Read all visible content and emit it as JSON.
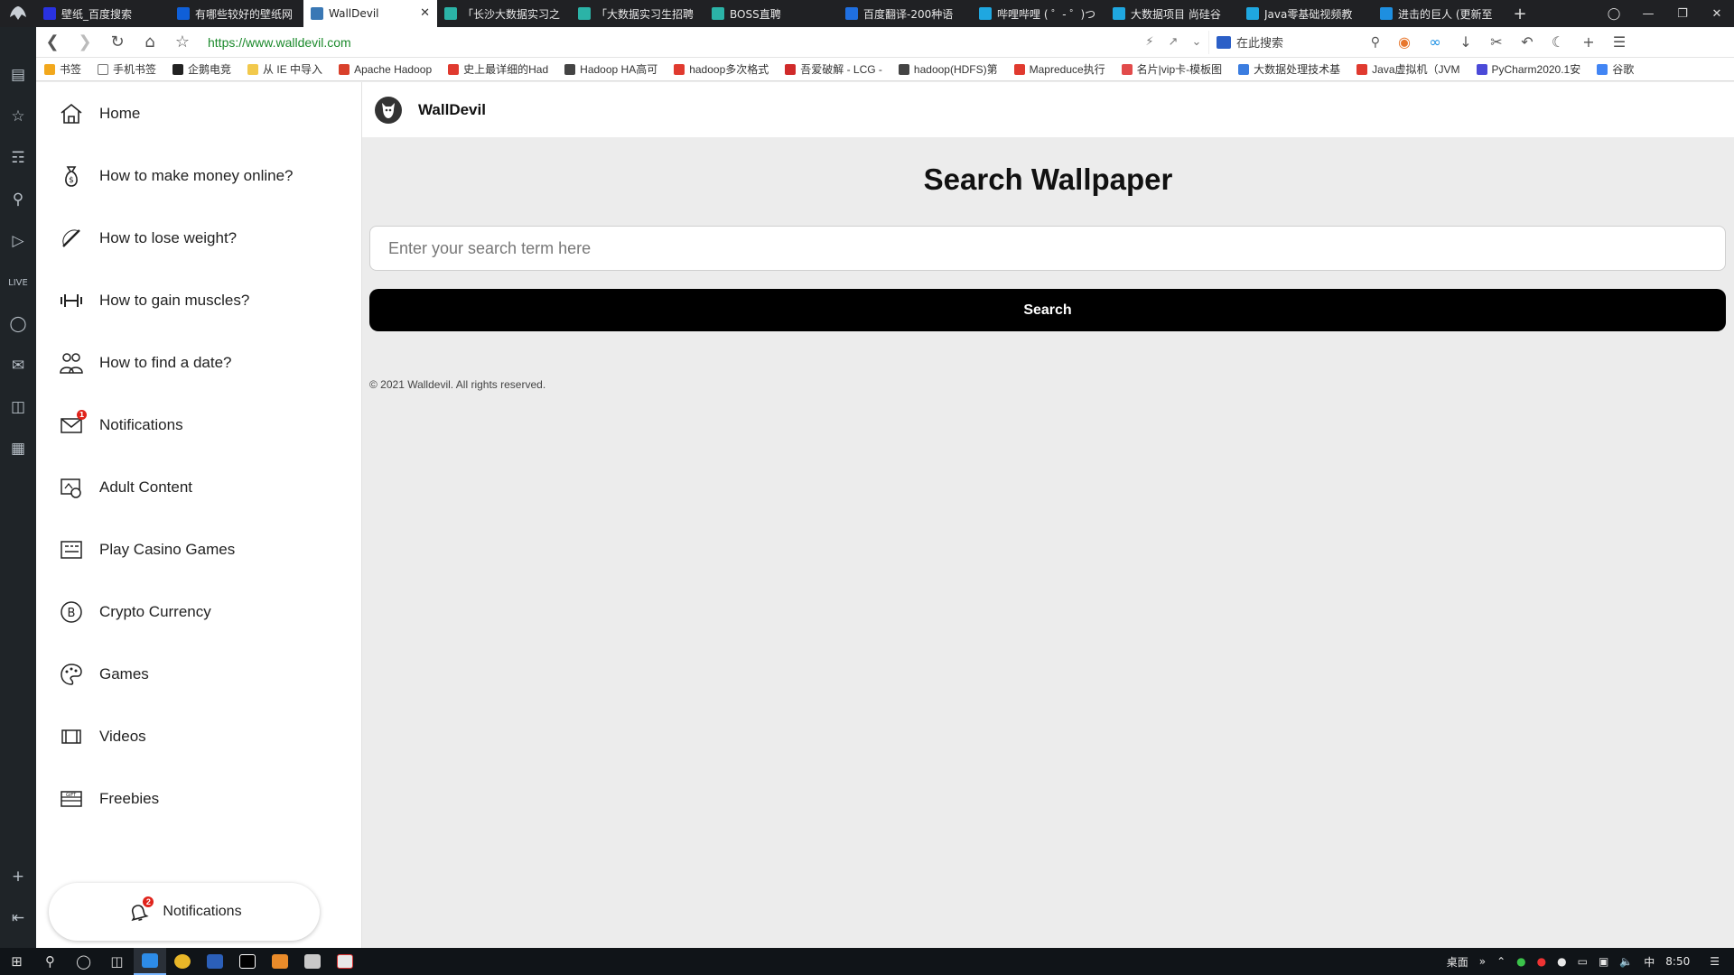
{
  "browser": {
    "tabs": [
      {
        "title": "壁纸_百度搜索",
        "icon": "baidu-icon",
        "color": "#2932e1",
        "glyph": "du"
      },
      {
        "title": "有哪些较好的壁纸网",
        "icon": "zhihu-icon",
        "color": "#0f5fd8",
        "glyph": "知"
      },
      {
        "title": "WallDevil",
        "icon": "wordpress-icon",
        "color": "#3a78b5",
        "glyph": "W",
        "active": true
      },
      {
        "title": "「长沙大数据实习之",
        "icon": "boss-icon",
        "color": "#2bb3a7",
        "glyph": "B"
      },
      {
        "title": "「大数据实习生招聘",
        "icon": "boss-icon",
        "color": "#2bb3a7",
        "glyph": "B"
      },
      {
        "title": "BOSS直聘",
        "icon": "boss-icon",
        "color": "#2bb3a7",
        "glyph": "B"
      },
      {
        "title": "百度翻译-200种语",
        "icon": "translate-icon",
        "color": "#1f6fe0",
        "glyph": "译"
      },
      {
        "title": "哔哩哔哩 ( ゜- ゜)つ",
        "icon": "bilibili-icon",
        "color": "#1fa7e0",
        "glyph": "b"
      },
      {
        "title": "大数据项目 尚硅谷",
        "icon": "bilibili-icon",
        "color": "#1fa7e0",
        "glyph": "b"
      },
      {
        "title": "Java零基础视频教",
        "icon": "bilibili-icon",
        "color": "#1fa7e0",
        "glyph": "b"
      },
      {
        "title": "进击的巨人 (更新至",
        "icon": "dd-icon",
        "color": "#1e8fe0",
        "glyph": "dd"
      }
    ],
    "url": "https://www.walldevil.com",
    "search_placeholder": "在此搜索",
    "bookmarks": [
      {
        "label": "书签",
        "color": "#f2a81d"
      },
      {
        "label": "手机书签",
        "color": "#ffffff"
      },
      {
        "label": "企鹅电竞",
        "color": "#222222"
      },
      {
        "label": "从 IE 中导入",
        "color": "#f2c94c"
      },
      {
        "label": "Apache Hadoop",
        "color": "#d9402b"
      },
      {
        "label": "史上最详细的Had",
        "color": "#e03a2f"
      },
      {
        "label": "Hadoop HA高可",
        "color": "#444444"
      },
      {
        "label": "hadoop多次格式",
        "color": "#e03a2f"
      },
      {
        "label": "吾爱破解 - LCG -",
        "color": "#d02a2a"
      },
      {
        "label": "hadoop(HDFS)第",
        "color": "#444444"
      },
      {
        "label": "Mapreduce执行",
        "color": "#e03a2f"
      },
      {
        "label": "名片|vip卡-模板图",
        "color": "#e24b4b"
      },
      {
        "label": "大数据处理技术基",
        "color": "#3b7de0"
      },
      {
        "label": "Java虚拟机（JVM",
        "color": "#e03a2f"
      },
      {
        "label": "PyCharm2020.1安",
        "color": "#4b4ad8"
      },
      {
        "label": "谷歌",
        "color": "#4285f4"
      }
    ]
  },
  "site": {
    "name": "WallDevil",
    "menu": [
      {
        "label": "Home",
        "icon": "home-icon"
      },
      {
        "label": "How to make money online?",
        "icon": "money-bag-icon"
      },
      {
        "label": "How to lose weight?",
        "icon": "jump-rope-icon"
      },
      {
        "label": "How to gain muscles?",
        "icon": "dumbbell-icon"
      },
      {
        "label": "How to find a date?",
        "icon": "couple-icon"
      },
      {
        "label": "Notifications",
        "icon": "mail-icon",
        "badge": "1"
      },
      {
        "label": "Adult Content",
        "icon": "adult-content-icon"
      },
      {
        "label": "Play Casino Games",
        "icon": "slot-machine-icon"
      },
      {
        "label": "Crypto Currency",
        "icon": "bitcoin-icon"
      },
      {
        "label": "Games",
        "icon": "palette-icon"
      },
      {
        "label": "Videos",
        "icon": "film-icon"
      },
      {
        "label": "Freebies",
        "icon": "gift-card-icon"
      }
    ],
    "notifications_button": {
      "label": "Notifications",
      "badge": "2"
    },
    "search": {
      "title": "Search Wallpaper",
      "placeholder": "Enter your search term here",
      "button_label": "Search"
    },
    "footer": "© 2021 Walldevil. All rights reserved."
  },
  "taskbar": {
    "tray_label": "桌面",
    "ime": "中",
    "time": "8:50"
  },
  "colors": {
    "accent_button": "#000000",
    "url_green": "#1c8a2c",
    "badge_red": "#e0231b"
  }
}
